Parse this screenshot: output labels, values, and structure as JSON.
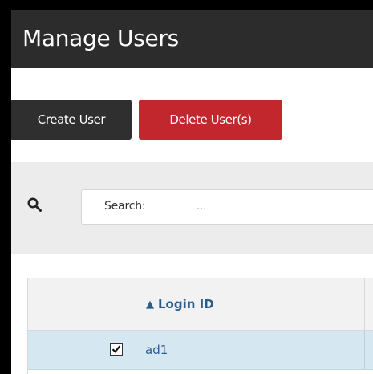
{
  "page": {
    "title": "Manage Users"
  },
  "toolbar": {
    "create_label": "Create User",
    "delete_label": "Delete User(s)"
  },
  "search": {
    "label": "Search:",
    "value": "..."
  },
  "table": {
    "columns": [
      "",
      "Login ID"
    ],
    "sort_indicator": "▲",
    "rows": [
      {
        "checked": true,
        "login_id": "ad1"
      }
    ]
  },
  "colors": {
    "title_bar": "#2c2c2c",
    "create_button": "#2f2f2f",
    "delete_button": "#c1272d",
    "link": "#2a5d8f",
    "selected_row": "#d5e8f2"
  },
  "icons": {
    "search": "search-icon",
    "sort": "sort-ascending-icon",
    "checkbox": "checkbox-checked-icon"
  }
}
